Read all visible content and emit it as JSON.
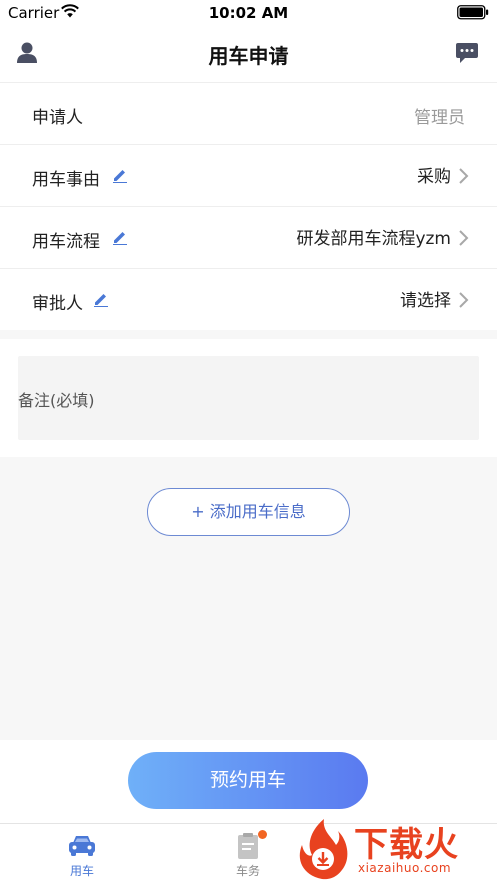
{
  "status_bar": {
    "carrier": "Carrier",
    "time": "10:02 AM"
  },
  "nav": {
    "title": "用车申请"
  },
  "form": {
    "applicant": {
      "label": "申请人",
      "value": "管理员"
    },
    "reason": {
      "label": "用车事由",
      "value": "采购"
    },
    "process": {
      "label": "用车流程",
      "value": "研发部用车流程yzm"
    },
    "approver": {
      "label": "审批人",
      "value": "请选择"
    }
  },
  "remark": {
    "placeholder": "备注(必填)"
  },
  "add_button": {
    "label": "+ 添加用车信息"
  },
  "reserve_button": {
    "label": "预约用车"
  },
  "tabs": [
    {
      "label": "用车",
      "icon": "car-icon",
      "active": true
    },
    {
      "label": "车务",
      "icon": "clipboard-icon",
      "active": false,
      "badge": true
    }
  ],
  "watermark": {
    "brand": "下载火",
    "domain": "xiazaihuo.com"
  },
  "colors": {
    "accent": "#4a78d6",
    "button_gradient_start": "#6fb0f8",
    "button_gradient_end": "#5a7af0",
    "badge": "#f26522"
  }
}
